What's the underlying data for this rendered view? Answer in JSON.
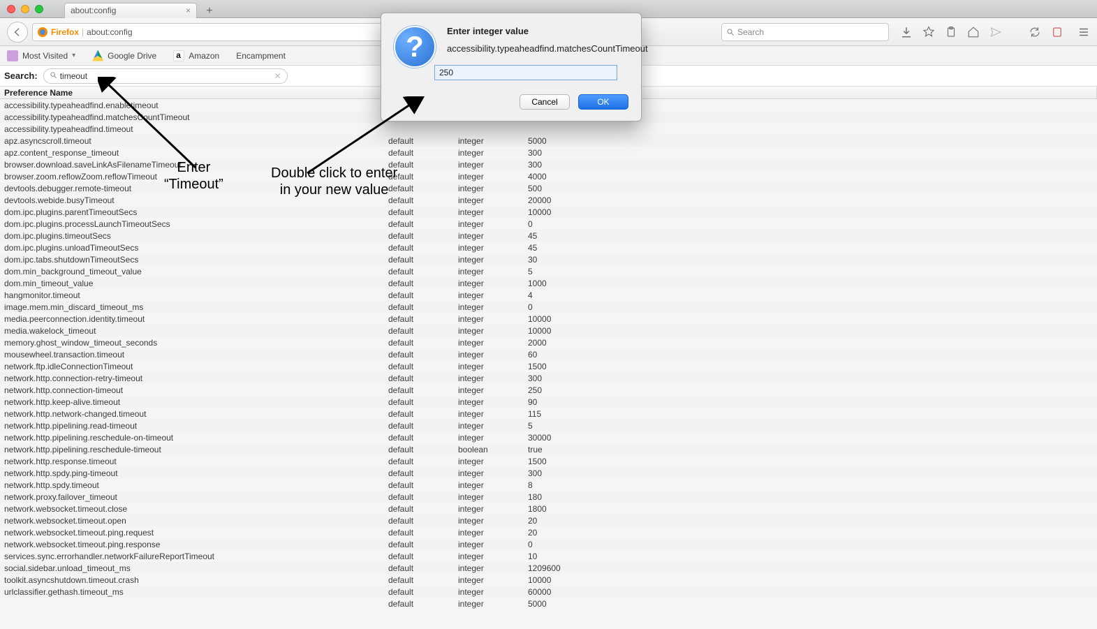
{
  "window": {
    "tab_title": "about:config",
    "url_prefix": "Firefox",
    "url_text": "about:config",
    "search_placeholder": "Search"
  },
  "bookmarks": {
    "most_visited": "Most Visited",
    "drive": "Google Drive",
    "amazon": "Amazon",
    "encampment": "Encampment"
  },
  "config": {
    "search_label": "Search:",
    "search_value": "timeout",
    "col_name": "Preference Name",
    "rows": [
      {
        "name": "accessibility.typeaheadfind.enabletimeout",
        "status": "",
        "type": "",
        "value": ""
      },
      {
        "name": "accessibility.typeaheadfind.matchesCountTimeout",
        "status": "",
        "type": "",
        "value": ""
      },
      {
        "name": "accessibility.typeaheadfind.timeout",
        "status": "",
        "type": "",
        "value": ""
      },
      {
        "name": "apz.asyncscroll.timeout",
        "status": "default",
        "type": "integer",
        "value": "5000"
      },
      {
        "name": "apz.content_response_timeout",
        "status": "default",
        "type": "integer",
        "value": "300"
      },
      {
        "name": "browser.download.saveLinkAsFilenameTimeout",
        "status": "default",
        "type": "integer",
        "value": "300"
      },
      {
        "name": "browser.zoom.reflowZoom.reflowTimeout",
        "status": "default",
        "type": "integer",
        "value": "4000"
      },
      {
        "name": "devtools.debugger.remote-timeout",
        "status": "default",
        "type": "integer",
        "value": "500"
      },
      {
        "name": "devtools.webide.busyTimeout",
        "status": "default",
        "type": "integer",
        "value": "20000"
      },
      {
        "name": "dom.ipc.plugins.parentTimeoutSecs",
        "status": "default",
        "type": "integer",
        "value": "10000"
      },
      {
        "name": "dom.ipc.plugins.processLaunchTimeoutSecs",
        "status": "default",
        "type": "integer",
        "value": "0"
      },
      {
        "name": "dom.ipc.plugins.timeoutSecs",
        "status": "default",
        "type": "integer",
        "value": "45"
      },
      {
        "name": "dom.ipc.plugins.unloadTimeoutSecs",
        "status": "default",
        "type": "integer",
        "value": "45"
      },
      {
        "name": "dom.ipc.tabs.shutdownTimeoutSecs",
        "status": "default",
        "type": "integer",
        "value": "30"
      },
      {
        "name": "dom.min_background_timeout_value",
        "status": "default",
        "type": "integer",
        "value": "5"
      },
      {
        "name": "dom.min_timeout_value",
        "status": "default",
        "type": "integer",
        "value": "1000"
      },
      {
        "name": "hangmonitor.timeout",
        "status": "default",
        "type": "integer",
        "value": "4"
      },
      {
        "name": "image.mem.min_discard_timeout_ms",
        "status": "default",
        "type": "integer",
        "value": "0"
      },
      {
        "name": "media.peerconnection.identity.timeout",
        "status": "default",
        "type": "integer",
        "value": "10000"
      },
      {
        "name": "media.wakelock_timeout",
        "status": "default",
        "type": "integer",
        "value": "10000"
      },
      {
        "name": "memory.ghost_window_timeout_seconds",
        "status": "default",
        "type": "integer",
        "value": "2000"
      },
      {
        "name": "mousewheel.transaction.timeout",
        "status": "default",
        "type": "integer",
        "value": "60"
      },
      {
        "name": "network.ftp.idleConnectionTimeout",
        "status": "default",
        "type": "integer",
        "value": "1500"
      },
      {
        "name": "network.http.connection-retry-timeout",
        "status": "default",
        "type": "integer",
        "value": "300"
      },
      {
        "name": "network.http.connection-timeout",
        "status": "default",
        "type": "integer",
        "value": "250"
      },
      {
        "name": "network.http.keep-alive.timeout",
        "status": "default",
        "type": "integer",
        "value": "90"
      },
      {
        "name": "network.http.network-changed.timeout",
        "status": "default",
        "type": "integer",
        "value": "115"
      },
      {
        "name": "network.http.pipelining.read-timeout",
        "status": "default",
        "type": "integer",
        "value": "5"
      },
      {
        "name": "network.http.pipelining.reschedule-on-timeout",
        "status": "default",
        "type": "integer",
        "value": "30000"
      },
      {
        "name": "network.http.pipelining.reschedule-timeout",
        "status": "default",
        "type": "boolean",
        "value": "true"
      },
      {
        "name": "network.http.response.timeout",
        "status": "default",
        "type": "integer",
        "value": "1500"
      },
      {
        "name": "network.http.spdy.ping-timeout",
        "status": "default",
        "type": "integer",
        "value": "300"
      },
      {
        "name": "network.http.spdy.timeout",
        "status": "default",
        "type": "integer",
        "value": "8"
      },
      {
        "name": "network.proxy.failover_timeout",
        "status": "default",
        "type": "integer",
        "value": "180"
      },
      {
        "name": "network.websocket.timeout.close",
        "status": "default",
        "type": "integer",
        "value": "1800"
      },
      {
        "name": "network.websocket.timeout.open",
        "status": "default",
        "type": "integer",
        "value": "20"
      },
      {
        "name": "network.websocket.timeout.ping.request",
        "status": "default",
        "type": "integer",
        "value": "20"
      },
      {
        "name": "network.websocket.timeout.ping.response",
        "status": "default",
        "type": "integer",
        "value": "0"
      },
      {
        "name": "services.sync.errorhandler.networkFailureReportTimeout",
        "status": "default",
        "type": "integer",
        "value": "10"
      },
      {
        "name": "social.sidebar.unload_timeout_ms",
        "status": "default",
        "type": "integer",
        "value": "1209600"
      },
      {
        "name": "toolkit.asyncshutdown.timeout.crash",
        "status": "default",
        "type": "integer",
        "value": "10000"
      },
      {
        "name": "urlclassifier.gethash.timeout_ms",
        "status": "default",
        "type": "integer",
        "value": "60000"
      },
      {
        "name": "",
        "status": "default",
        "type": "integer",
        "value": "5000"
      }
    ]
  },
  "dialog": {
    "title": "Enter integer value",
    "pref": "accessibility.typeaheadfind.matchesCountTimeout",
    "value": "250",
    "cancel": "Cancel",
    "ok": "OK"
  },
  "annotations": {
    "a1_line1": "Enter",
    "a1_line2": "“Timeout”",
    "a2_line1": "Double click to enter",
    "a2_line2": "in your new value"
  }
}
